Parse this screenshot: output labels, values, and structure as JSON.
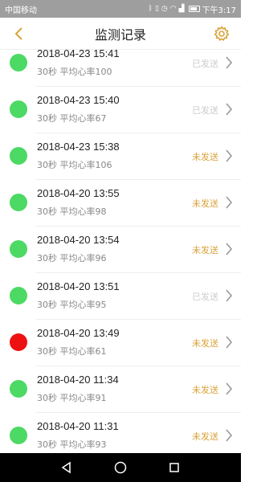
{
  "status_bar": {
    "carrier": "中国移动",
    "time": "下午3:17"
  },
  "header": {
    "title": "监测记录",
    "accent_color": "#d9a23a"
  },
  "records": [
    {
      "datetime": "2018-04-23 15:41",
      "meta": "30秒  平均心率100",
      "status": "已发送",
      "sent": true,
      "level": "ok"
    },
    {
      "datetime": "2018-04-23 15:40",
      "meta": "30秒  平均心率67",
      "status": "已发送",
      "sent": true,
      "level": "ok"
    },
    {
      "datetime": "2018-04-23 15:38",
      "meta": "30秒  平均心率106",
      "status": "未发送",
      "sent": false,
      "level": "ok"
    },
    {
      "datetime": "2018-04-20 13:55",
      "meta": "30秒  平均心率98",
      "status": "未发送",
      "sent": false,
      "level": "ok"
    },
    {
      "datetime": "2018-04-20 13:54",
      "meta": "30秒  平均心率96",
      "status": "未发送",
      "sent": false,
      "level": "ok"
    },
    {
      "datetime": "2018-04-20 13:51",
      "meta": "30秒  平均心率95",
      "status": "已发送",
      "sent": true,
      "level": "ok"
    },
    {
      "datetime": "2018-04-20 13:49",
      "meta": "30秒  平均心率61",
      "status": "未发送",
      "sent": false,
      "level": "alert"
    },
    {
      "datetime": "2018-04-20 11:34",
      "meta": "30秒  平均心率91",
      "status": "未发送",
      "sent": false,
      "level": "ok"
    },
    {
      "datetime": "2018-04-20 11:31",
      "meta": "30秒  平均心率93",
      "status": "未发送",
      "sent": false,
      "level": "ok"
    }
  ],
  "colors": {
    "dot_ok": "#4cd964",
    "dot_alert": "#ee1111",
    "sent_text": "#cccccc",
    "unsent_text": "#d9a23a"
  },
  "icons": {
    "back": "back-arrow-icon",
    "settings": "gear-icon",
    "chevron": "chevron-right-icon",
    "nav_back": "triangle-back-icon",
    "nav_home": "circle-home-icon",
    "nav_recent": "square-recent-icon"
  }
}
